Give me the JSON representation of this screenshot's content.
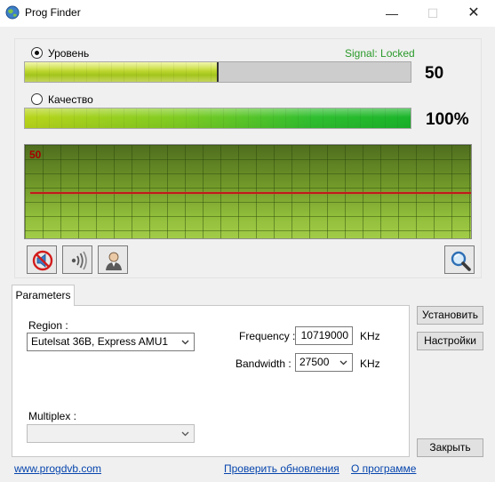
{
  "window": {
    "title": "Prog Finder",
    "controls": {
      "minimize": "—",
      "maximize": "☐",
      "close": "✕"
    }
  },
  "signal": {
    "level_label": "Уровень",
    "level_selected": true,
    "status_text": "Signal: Locked",
    "level_value": "50",
    "level_fraction": 0.5,
    "quality_label": "Качество",
    "quality_selected": false,
    "quality_value": "100%",
    "quality_fraction": 1.0
  },
  "graph": {
    "value_label": "50",
    "line_level": 50,
    "range": [
      0,
      100
    ],
    "line_color": "#c11a1a"
  },
  "toolbar": {
    "sound_icon": "speaker-muted-icon",
    "signal_icon": "signal-waves-icon",
    "user_icon": "user-icon",
    "search_icon": "magnifier-icon"
  },
  "parameters": {
    "tab_label": "Parameters",
    "region_label": "Region :",
    "region_value": "Eutelsat 36B, Express AMU1",
    "multiplex_label": "Multiplex :",
    "multiplex_value": "",
    "frequency_label": "Frequency :",
    "frequency_value": "10719000",
    "frequency_unit": "KHz",
    "bandwidth_label": "Bandwidth :",
    "bandwidth_value": "27500",
    "bandwidth_unit": "KHz"
  },
  "buttons": {
    "set": "Установить",
    "settings": "Настройки",
    "close": "Закрыть"
  },
  "links": {
    "website": "www.progdvb.com",
    "check_updates": "Проверить обновления",
    "about": "О программе"
  }
}
